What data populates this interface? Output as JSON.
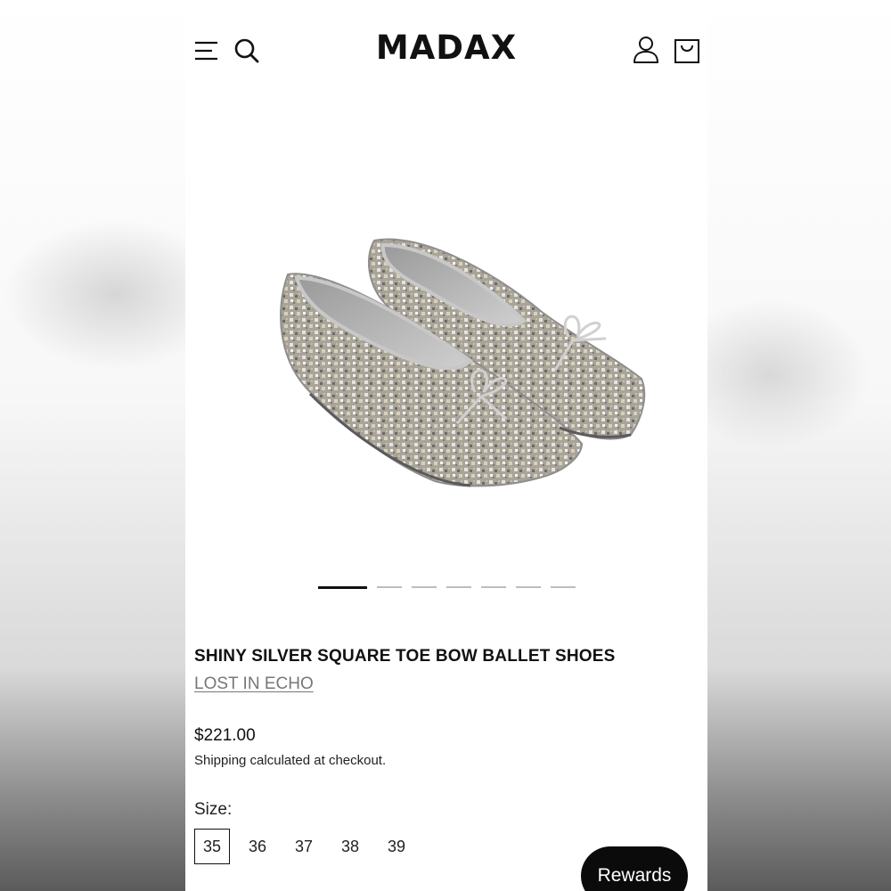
{
  "header": {
    "logo": "MADAX",
    "icons": [
      "menu-icon",
      "search-icon",
      "account-icon",
      "cart-icon"
    ]
  },
  "product": {
    "image_alt": "Shiny silver glitter square toe ballet flats with bows",
    "gallery": {
      "count": 7,
      "active_index": 0
    },
    "title": "SHINY SILVER SQUARE TOE BOW BALLET SHOES",
    "vendor": "LOST IN ECHO",
    "price": "$221.00",
    "shipping_note": "Shipping calculated at checkout.",
    "size_label": "Size:",
    "sizes": [
      "35",
      "36",
      "37",
      "38",
      "39"
    ],
    "selected_size": "35"
  },
  "rewards": {
    "label": "Rewards"
  },
  "colors": {
    "text": "#111111",
    "vendor": "#777777",
    "rewards_bg": "#0b0b0b"
  }
}
